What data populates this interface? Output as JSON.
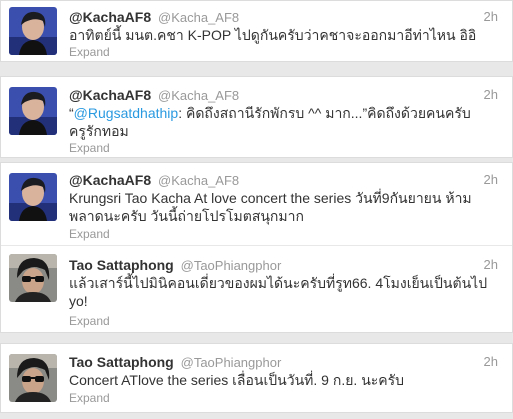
{
  "tweets": [
    {
      "name": "@KachaAF8",
      "handle": "@Kacha_AF8",
      "time": "2h",
      "text": "อาทิตย์นี้ มนต.คชา K-POP ไปดูกันครับว่าคชาจะออกมาอีท่าไหน อิอิ",
      "expand": "Expand",
      "avatar": "avatar-kacha"
    },
    {
      "name": "@KachaAF8",
      "handle": "@Kacha_AF8",
      "time": "2h",
      "quote_open": "“",
      "mention": "@Rugsatdhathip",
      "text": ": คิดถึงสถานีรักพักรบ ^^ มาก...”คิดถึงด้วยคนครับ ครูรักทอม",
      "expand": "Expand",
      "avatar": "avatar-kacha"
    },
    {
      "name": "@KachaAF8",
      "handle": "@Kacha_AF8",
      "time": "2h",
      "text": "Krungsri Tao Kacha At love concert the series วันที่9กันยายน ห้ามพลาดนะครับ วันนี้ถ่ายโปรโมตสนุกมาก",
      "expand": "Expand",
      "avatar": "avatar-kacha"
    },
    {
      "name": "Tao Sattaphong",
      "handle": "@TaoPhiangphor",
      "time": "2h",
      "text": "แล้วเสาร์นี้ไปมินิคอนเดี่ยวของผมได้นะครับที่รูท66. 4โมงเย็นเป็นต้นไป yo!",
      "expand": "Expand",
      "avatar": "avatar-tao"
    },
    {
      "name": "Tao Sattaphong",
      "handle": "@TaoPhiangphor",
      "time": "2h",
      "text": "Concert ATlove the series เลื่อนเป็นวันที่. 9 ก.ย. นะครับ",
      "expand": "Expand",
      "avatar": "avatar-tao"
    }
  ]
}
